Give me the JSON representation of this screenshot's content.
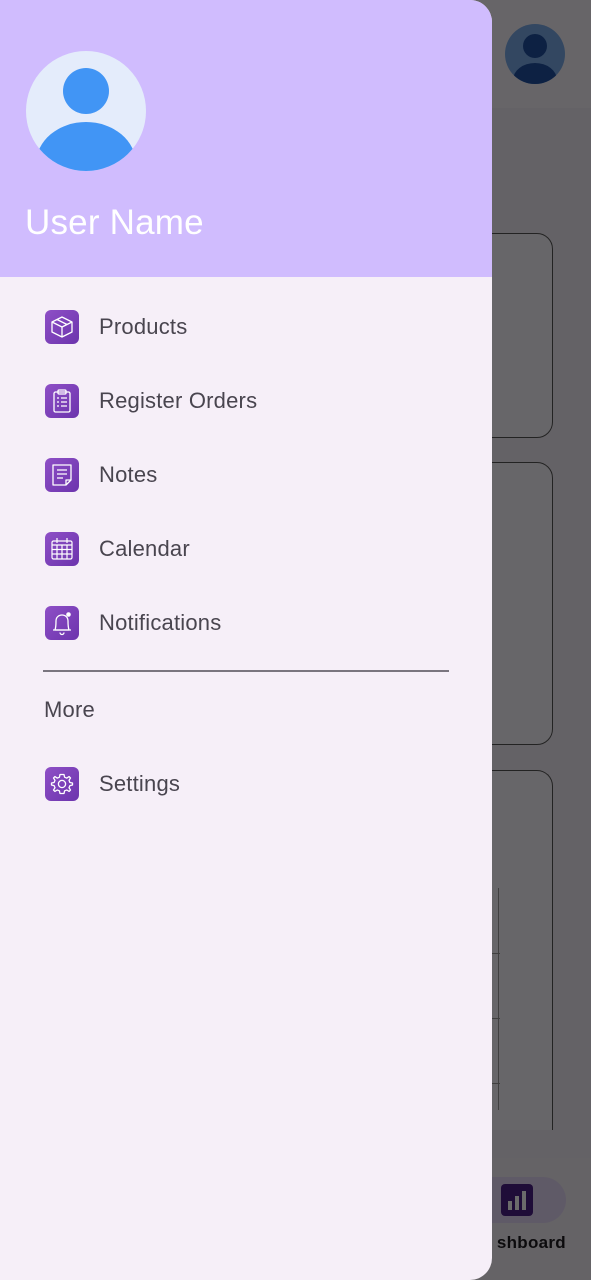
{
  "drawer": {
    "user_name": "User Name",
    "menu_items": [
      {
        "label": "Products",
        "icon": "box-icon"
      },
      {
        "label": "Register Orders",
        "icon": "clipboard-icon"
      },
      {
        "label": "Notes",
        "icon": "note-icon"
      },
      {
        "label": "Calendar",
        "icon": "calendar-icon"
      },
      {
        "label": "Notifications",
        "icon": "bell-icon"
      }
    ],
    "more_section": {
      "title": "More",
      "items": [
        {
          "label": "Settings",
          "icon": "gear-icon"
        }
      ]
    }
  },
  "background": {
    "bottom_nav": {
      "selected_label": "shboard",
      "selected_icon": "bar-chart-icon"
    }
  },
  "colors": {
    "header": "#d0bcfe",
    "drawer_bg": "#f6eff8",
    "icon_purple": "#7b3fb8",
    "text": "#49454f",
    "avatar_blue": "#4195f5"
  }
}
